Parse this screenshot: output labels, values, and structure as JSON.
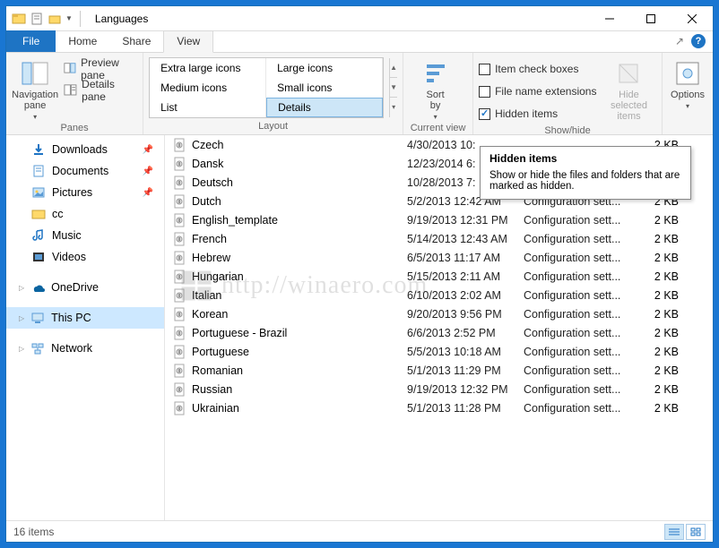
{
  "window": {
    "title": "Languages"
  },
  "tabs": {
    "file": "File",
    "home": "Home",
    "share": "Share",
    "view": "View"
  },
  "ribbon": {
    "panes": {
      "label": "Panes",
      "nav": "Navigation\npane",
      "preview": "Preview pane",
      "details": "Details pane"
    },
    "layout": {
      "label": "Layout",
      "xl": "Extra large icons",
      "lg": "Large icons",
      "md": "Medium icons",
      "sm": "Small icons",
      "list": "List",
      "details": "Details"
    },
    "currentview": {
      "label": "Current view",
      "sort": "Sort\nby"
    },
    "showhide": {
      "label": "Show/hide",
      "itemcheck": "Item check boxes",
      "fileext": "File name extensions",
      "hidden": "Hidden items",
      "hidesel": "Hide selected\nitems"
    },
    "options": "Options"
  },
  "tooltip": {
    "title": "Hidden items",
    "body": "Show or hide the files and folders that are marked as hidden."
  },
  "nav": {
    "downloads": "Downloads",
    "documents": "Documents",
    "pictures": "Pictures",
    "cc": "cc",
    "music": "Music",
    "videos": "Videos",
    "onedrive": "OneDrive",
    "thispc": "This PC",
    "network": "Network"
  },
  "files": [
    {
      "name": "Czech",
      "date": "4/30/2013 10:",
      "type": "",
      "size": "2 KB"
    },
    {
      "name": "Dansk",
      "date": "12/23/2014 6:",
      "type": "",
      "size": "2 KB"
    },
    {
      "name": "Deutsch",
      "date": "10/28/2013 7:",
      "type": "",
      "size": "2 KB"
    },
    {
      "name": "Dutch",
      "date": "5/2/2013 12:42 AM",
      "type": "Configuration sett...",
      "size": "2 KB"
    },
    {
      "name": "English_template",
      "date": "9/19/2013 12:31 PM",
      "type": "Configuration sett...",
      "size": "2 KB"
    },
    {
      "name": "French",
      "date": "5/14/2013 12:43 AM",
      "type": "Configuration sett...",
      "size": "2 KB"
    },
    {
      "name": "Hebrew",
      "date": "6/5/2013 11:17 AM",
      "type": "Configuration sett...",
      "size": "2 KB"
    },
    {
      "name": "Hungarian",
      "date": "5/15/2013 2:11 AM",
      "type": "Configuration sett...",
      "size": "2 KB"
    },
    {
      "name": "Italian",
      "date": "6/10/2013 2:02 AM",
      "type": "Configuration sett...",
      "size": "2 KB"
    },
    {
      "name": "Korean",
      "date": "9/20/2013 9:56 PM",
      "type": "Configuration sett...",
      "size": "2 KB"
    },
    {
      "name": "Portuguese - Brazil",
      "date": "6/6/2013 2:52 PM",
      "type": "Configuration sett...",
      "size": "2 KB"
    },
    {
      "name": "Portuguese",
      "date": "5/5/2013 10:18 AM",
      "type": "Configuration sett...",
      "size": "2 KB"
    },
    {
      "name": "Romanian",
      "date": "5/1/2013 11:29 PM",
      "type": "Configuration sett...",
      "size": "2 KB"
    },
    {
      "name": "Russian",
      "date": "9/19/2013 12:32 PM",
      "type": "Configuration sett...",
      "size": "2 KB"
    },
    {
      "name": "Ukrainian",
      "date": "5/1/2013 11:28 PM",
      "type": "Configuration sett...",
      "size": "2 KB"
    }
  ],
  "status": {
    "count": "16 items"
  },
  "watermark": "http://winaero.com"
}
